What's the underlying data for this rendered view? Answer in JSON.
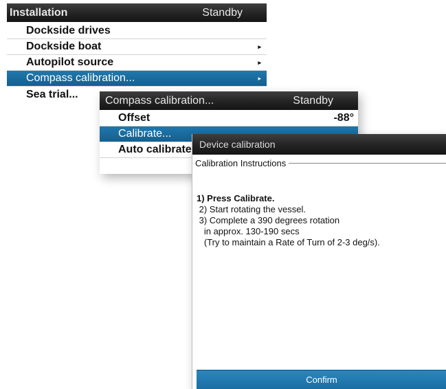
{
  "installation_menu": {
    "title": "Installation",
    "status": "Standby",
    "items": [
      {
        "label": "Dockside drives",
        "arrow": ""
      },
      {
        "label": "Dockside boat",
        "arrow": "▸"
      },
      {
        "label": "Autopilot source",
        "arrow": "▸"
      },
      {
        "label": "Compass calibration...",
        "arrow": "▸"
      },
      {
        "label": "Sea trial...",
        "arrow": ""
      }
    ],
    "selected_index": 3
  },
  "compass_menu": {
    "title": "Compass calibration...",
    "status": "Standby",
    "items": [
      {
        "label": "Offset",
        "value": "-88°"
      },
      {
        "label": "Calibrate...",
        "value": ""
      },
      {
        "label": "Auto calibrate...",
        "value": ""
      }
    ],
    "selected_index": 1
  },
  "device_calibration": {
    "title": "Device calibration",
    "group_title": "Calibration Instructions",
    "instructions": [
      "1) Press Calibrate.",
      " 2) Start rotating the vessel.",
      " 3) Complete a 390 degrees rotation",
      "   in approx. 130-190 secs",
      "   (Try to maintain a Rate of Turn of 2-3 deg/s)."
    ],
    "confirm_label": "Confirm"
  },
  "colors": {
    "accent": "#1a6ea3",
    "titlebar": "#232323"
  }
}
